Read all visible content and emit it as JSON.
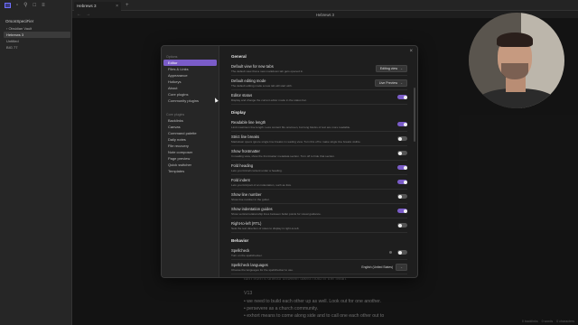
{
  "app": {
    "vault_name": "OrsonSpeciFier",
    "tab_title": "Hebrews 3",
    "breadcrumb": "Hebrews 3",
    "note_title": "Hebrews 3"
  },
  "ribbon": {
    "icons": [
      "sidebar-toggle-icon",
      "folder-icon",
      "search-icon",
      "bookmark-icon",
      "tags-icon"
    ]
  },
  "file_tree": [
    {
      "label": "› Obsidian Vault",
      "active": false
    },
    {
      "label": "Hebrews 3",
      "active": true
    },
    {
      "label": "Untitled",
      "active": false
    },
    {
      "label": "BIG 77",
      "active": false
    }
  ],
  "note_body": [
    "turn from it unless unbelief takes hold in the heart",
    "",
    "V13",
    "• we need to build each other up as well. Look out for one another.",
    "• persevere as a church community.",
    "• exhort means to come along side and to call one each other out to"
  ],
  "status_bar": [
    "0 backlinks",
    "0 words",
    "0 characters"
  ],
  "settings": {
    "nav_options_heading": "Options",
    "nav_options": [
      {
        "label": "Editor",
        "active": true
      },
      {
        "label": "Files & Links",
        "active": false
      },
      {
        "label": "Appearance",
        "active": false
      },
      {
        "label": "Hotkeys",
        "active": false
      },
      {
        "label": "About",
        "active": false
      },
      {
        "label": "Core plugins",
        "active": false
      },
      {
        "label": "Community plugins",
        "active": false
      }
    ],
    "nav_core_heading": "Core plugins",
    "nav_core": [
      {
        "label": "Backlinks"
      },
      {
        "label": "Canvas"
      },
      {
        "label": "Command palette"
      },
      {
        "label": "Daily notes"
      },
      {
        "label": "File recovery"
      },
      {
        "label": "Note composer"
      },
      {
        "label": "Page preview"
      },
      {
        "label": "Quick switcher"
      },
      {
        "label": "Templates"
      }
    ],
    "general_heading": "General",
    "general": [
      {
        "name": "Default view for new tabs",
        "desc": "The default view that a new markdown tab gets opened in.",
        "control": "dropdown",
        "value": "Editing view"
      },
      {
        "name": "Default editing mode",
        "desc": "The default editing mode a new tab will start with.",
        "control": "dropdown",
        "value": "Live Preview"
      },
      {
        "name": "Editor status",
        "desc": "Display and change the current editor mode in the status bar.",
        "control": "toggle",
        "on": true
      }
    ],
    "display_heading": "Display",
    "display": [
      {
        "name": "Readable line length",
        "desc": "Limit maximum line length. Less content fits onscreen, but long blocks of text are more readable.",
        "control": "toggle",
        "on": true
      },
      {
        "name": "Strict line breaks",
        "desc": "Markdown specs ignore single line breaks in reading view. Turn this off to make single line breaks visible.",
        "control": "toggle",
        "on": false
      },
      {
        "name": "Show frontmatter",
        "desc": "In reading view, show the frontmatter metadata section. Turn off to hide that section.",
        "control": "toggle",
        "on": false
      },
      {
        "name": "Fold heading",
        "desc": "Lets you fold all content under a heading.",
        "control": "toggle",
        "on": true
      },
      {
        "name": "Fold indent",
        "desc": "Lets you fold part of an indentation, such as lists.",
        "control": "toggle",
        "on": true
      },
      {
        "name": "Show line number",
        "desc": "Show line number in the gutter.",
        "control": "toggle",
        "on": false
      },
      {
        "name": "Show indentation guides",
        "desc": "Show vertical relationship lines between bullet points for visual guidance.",
        "control": "toggle",
        "on": true
      },
      {
        "name": "Right-to-left (RTL)",
        "desc": "Sets the text direction of notes to display in right-to-left.",
        "control": "toggle",
        "on": false
      }
    ],
    "behavior_heading": "Behavior",
    "behavior": [
      {
        "name": "Spellcheck",
        "desc": "Turn on the spellchecker.",
        "control": "toggle",
        "on": false
      },
      {
        "name": "Spellcheck languages",
        "desc": "Choose the languages for the spellchecker to use.",
        "control": "language",
        "value": "English (United States)"
      }
    ]
  },
  "colors": {
    "accent": "#7a5cc8",
    "background": "#1e1e1e",
    "sidebar": "#262626"
  }
}
